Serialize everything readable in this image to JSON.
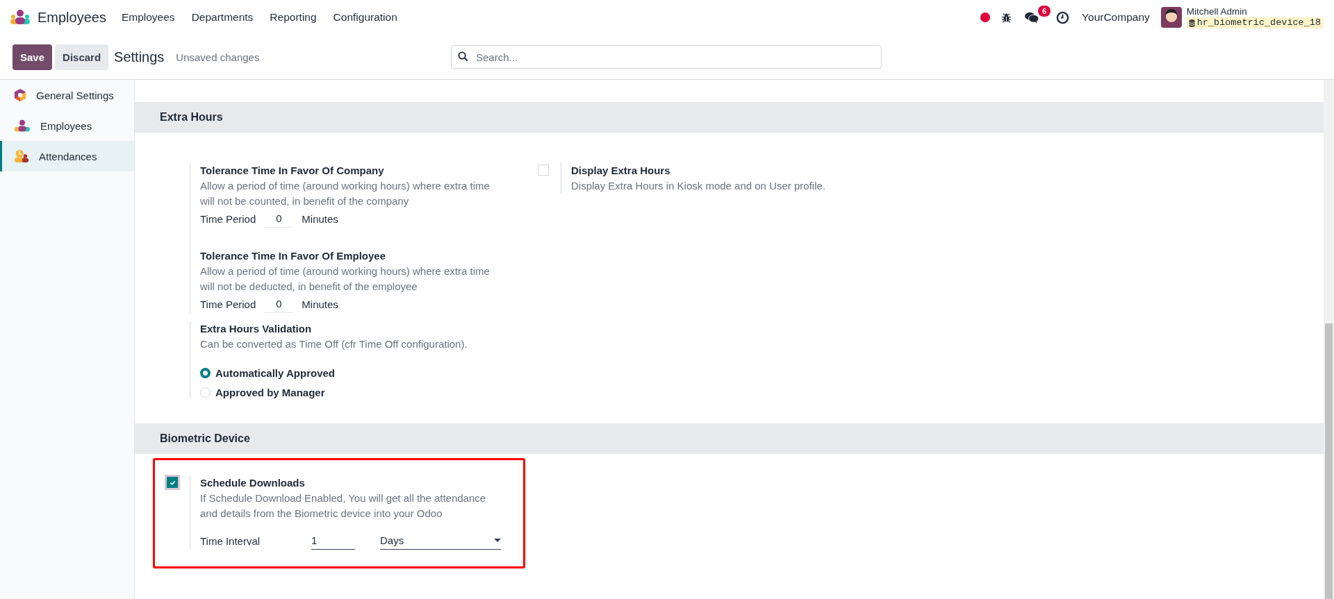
{
  "navbar": {
    "app_name": "Employees",
    "menu": [
      "Employees",
      "Departments",
      "Reporting",
      "Configuration"
    ],
    "messages_badge": "6",
    "company": "YourCompany",
    "user_name": "Mitchell Admin",
    "database": "hr_biometric_device_18"
  },
  "control_panel": {
    "save": "Save",
    "discard": "Discard",
    "title": "Settings",
    "status": "Unsaved changes",
    "search": {
      "placeholder": "Search..."
    }
  },
  "sidebar": {
    "items": [
      {
        "label": "General Settings",
        "kind": "general",
        "selected": false
      },
      {
        "label": "Employees",
        "kind": "employees",
        "selected": false
      },
      {
        "label": "Attendances",
        "kind": "attendances",
        "selected": true
      }
    ]
  },
  "sections": [
    {
      "title": "Extra Hours",
      "highlighted": false,
      "left": [
        {
          "group": [
            {
              "kind": "period",
              "title": "Tolerance Time In Favor Of Company",
              "description": "Allow a period of time (around working hours) where extra time will not be counted, in benefit of the company",
              "field_label": "Time Period",
              "value": "0",
              "unit": "Minutes"
            },
            {
              "kind": "period",
              "title": "Tolerance Time In Favor Of Employee",
              "description": "Allow a period of time (around working hours) where extra time will not be deducted, in benefit of the employee",
              "field_label": "Time Period",
              "value": "0",
              "unit": "Minutes"
            }
          ]
        },
        {
          "group": [
            {
              "kind": "radio",
              "title": "Extra Hours Validation",
              "description": "Can be converted as Time Off (cfr Time Off configuration).",
              "options": [
                {
                  "label": "Automatically Approved",
                  "selected": true
                },
                {
                  "label": "Approved by Manager",
                  "selected": false
                }
              ]
            }
          ]
        }
      ],
      "right": [
        {
          "kind": "checkbox",
          "title": "Display Extra Hours",
          "description": "Display Extra Hours in Kiosk mode and on User profile.",
          "checked": false
        }
      ]
    },
    {
      "title": "Biometric Device",
      "highlighted": true,
      "left": [
        {
          "group": [
            {
              "kind": "interval",
              "checked": true,
              "title": "Schedule Downloads",
              "description": "If Schedule Download Enabled, You will get all the attendance and details from the Biometric device into your Odoo",
              "field_label": "Time Interval",
              "value": "1",
              "unit": "Days"
            }
          ]
        }
      ]
    }
  ]
}
